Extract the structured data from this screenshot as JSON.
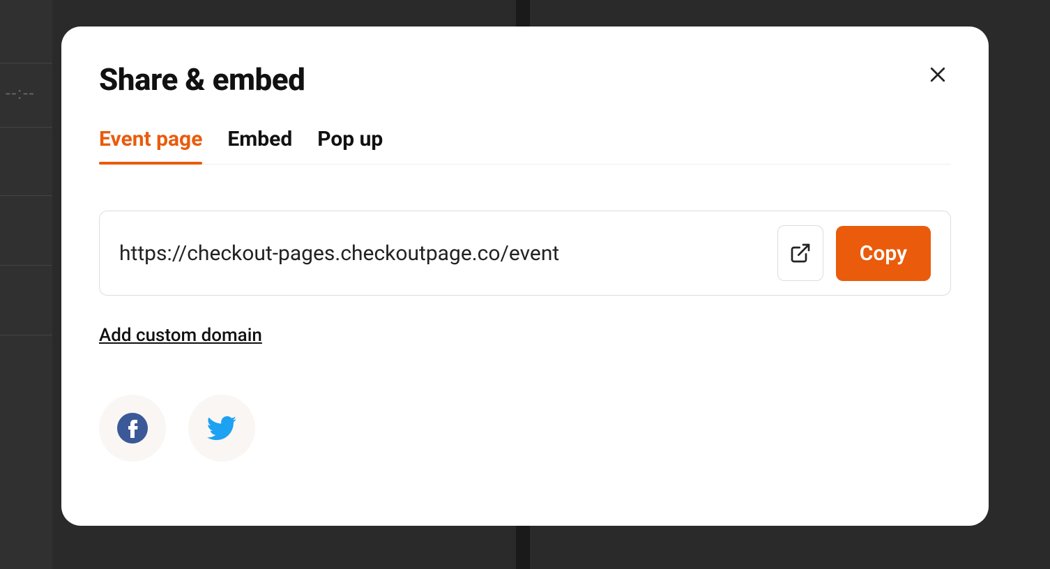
{
  "modal": {
    "title": "Share & embed",
    "tabs": [
      {
        "label": "Event page",
        "active": true
      },
      {
        "label": "Embed",
        "active": false
      },
      {
        "label": "Pop up",
        "active": false
      }
    ],
    "url": "https://checkout-pages.checkoutpage.co/event",
    "copy_label": "Copy",
    "custom_domain_label": "Add custom domain",
    "social_icons": [
      "facebook-icon",
      "twitter-icon"
    ]
  },
  "background": {
    "placeholder_text": "--:--"
  },
  "colors": {
    "accent": "#ea5b0c",
    "facebook": "#3b5998",
    "twitter": "#1da1f2"
  }
}
